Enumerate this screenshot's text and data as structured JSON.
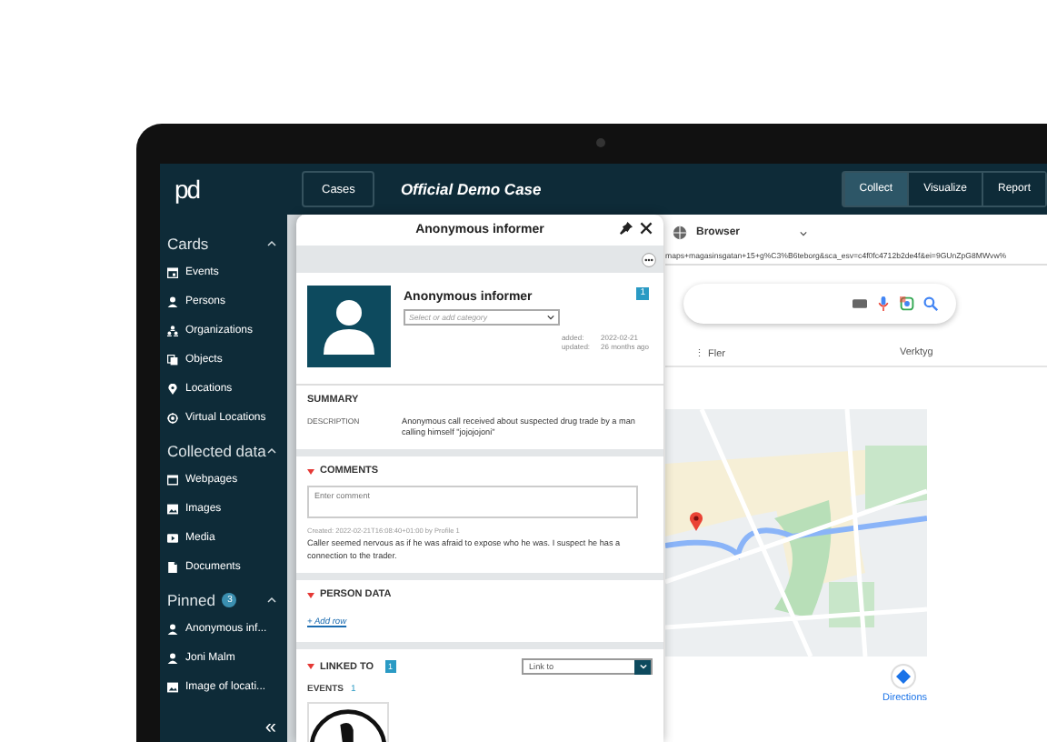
{
  "app": {
    "logo": "pd",
    "cases_button": "Cases",
    "case_title": "Official Demo Case",
    "modes": [
      {
        "label": "Collect",
        "selected": true
      },
      {
        "label": "Visualize",
        "selected": false
      },
      {
        "label": "Report",
        "selected": false
      }
    ]
  },
  "sidebar": {
    "sections": [
      {
        "title": "Cards",
        "expanded": true,
        "items": [
          {
            "label": "Events",
            "kind": "calendar"
          },
          {
            "label": "Persons",
            "kind": "person"
          },
          {
            "label": "Organizations",
            "kind": "organization"
          },
          {
            "label": "Objects",
            "kind": "object"
          },
          {
            "label": "Locations",
            "kind": "location"
          },
          {
            "label": "Virtual Locations",
            "kind": "virtual"
          }
        ]
      },
      {
        "title": "Collected data",
        "expanded": true,
        "items": [
          {
            "label": "Webpages",
            "kind": "webpage"
          },
          {
            "label": "Images",
            "kind": "image"
          },
          {
            "label": "Media",
            "kind": "media"
          },
          {
            "label": "Documents",
            "kind": "document"
          }
        ]
      },
      {
        "title": "Pinned",
        "count": "3",
        "expanded": true,
        "items": [
          {
            "label": "Anonymous inf...",
            "kind": "person"
          },
          {
            "label": "Joni Malm",
            "kind": "person"
          },
          {
            "label": "Image of locati...",
            "kind": "image"
          }
        ]
      }
    ],
    "collapse_glyph": "«"
  },
  "browser": {
    "label": "Browser",
    "url": "maps+magasinsgatan+15+g%C3%B6teborg&sca_esv=c4f0fc4712b2de4f&ei=9GUnZpG8MWvw%",
    "tabs": [
      "⋮ Fler",
      "Verktyg"
    ],
    "directions": "Directions"
  },
  "card": {
    "title": "Anonymous informer",
    "name": "Anonymous informer",
    "category_placeholder": "Select or add category",
    "badge": "1",
    "added_label": "added:",
    "added": "2022-02-21",
    "updated_label": "updated:",
    "updated": "26 months ago",
    "summary_heading": "SUMMARY",
    "description_label": "DESCRIPTION",
    "description": "Anonymous call received about suspected drug trade by a man calling himself \"jojojojoni\"",
    "comments": {
      "heading": "COMMENTS",
      "expanded": true,
      "placeholder": "Enter comment",
      "meta": "Created: 2022-02-21T16:08:40+01:00 by Profile 1",
      "text": "Caller seemed nervous as if he was afraid to expose who he was. I suspect he has a connection to the trader."
    },
    "person_data": {
      "heading": "PERSON DATA",
      "expanded": true,
      "add_link": "+ Add row"
    },
    "linked_to": {
      "heading": "LINKED TO",
      "expanded": true,
      "count": "1",
      "link_placeholder": "Link to",
      "events_label": "EVENTS",
      "events_count": "1"
    }
  }
}
